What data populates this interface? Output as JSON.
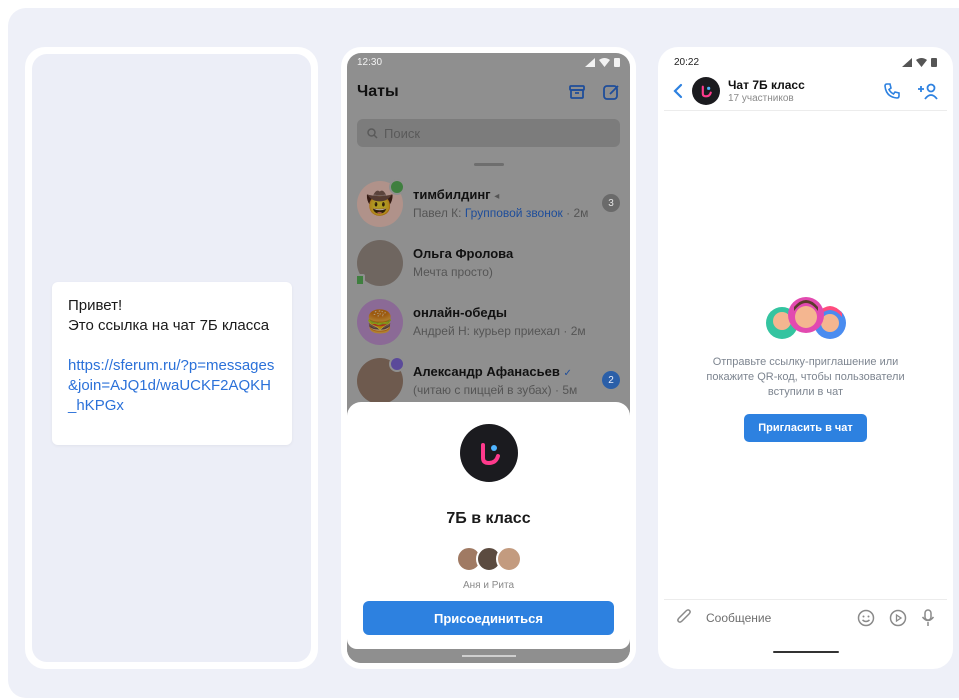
{
  "panel1": {
    "message_line1": "Привет!",
    "message_line2": "Это ссылка на чат 7Б класса",
    "link": "https://sferum.ru/?p=messages&join=AJQ1d/waUCKF2AQKH_hKPGx"
  },
  "panel2": {
    "status_time": "12:30",
    "title": "Чаты",
    "search_placeholder": "Поиск",
    "chats": [
      {
        "name": "тимбилдинг",
        "sender": "Павел К:",
        "preview": "Групповой звонок",
        "time": "· 2м",
        "badge": "3"
      },
      {
        "name": "Ольга Фролова",
        "sender": "",
        "preview": "Мечта просто)",
        "time": "",
        "badge": ""
      },
      {
        "name": "онлайн-обеды",
        "sender": "Андрей Н:",
        "preview": "курьер приехал",
        "time": "· 2м",
        "badge": ""
      },
      {
        "name": "Александр Афанасьев",
        "sender": "",
        "preview": "(читаю с пиццей в зубах)",
        "time": "· 5м",
        "badge": "2"
      }
    ],
    "sheet": {
      "title": "7Б в класс",
      "members": "Аня и Рита",
      "join_label": "Присоединиться"
    }
  },
  "panel3": {
    "status_time": "20:22",
    "chat_title": "Чат 7Б класс",
    "chat_subtitle": "17 участников",
    "empty_text": "Отправьте ссылку-приглашение или покажите QR-код, чтобы пользователи вступили в чат",
    "invite_label": "Пригласить в чат",
    "composer_placeholder": "Сообщение"
  },
  "colors": {
    "accent": "#2d81e0",
    "stage_bg": "#eef0f8",
    "overlay": "#8f8f8f"
  }
}
